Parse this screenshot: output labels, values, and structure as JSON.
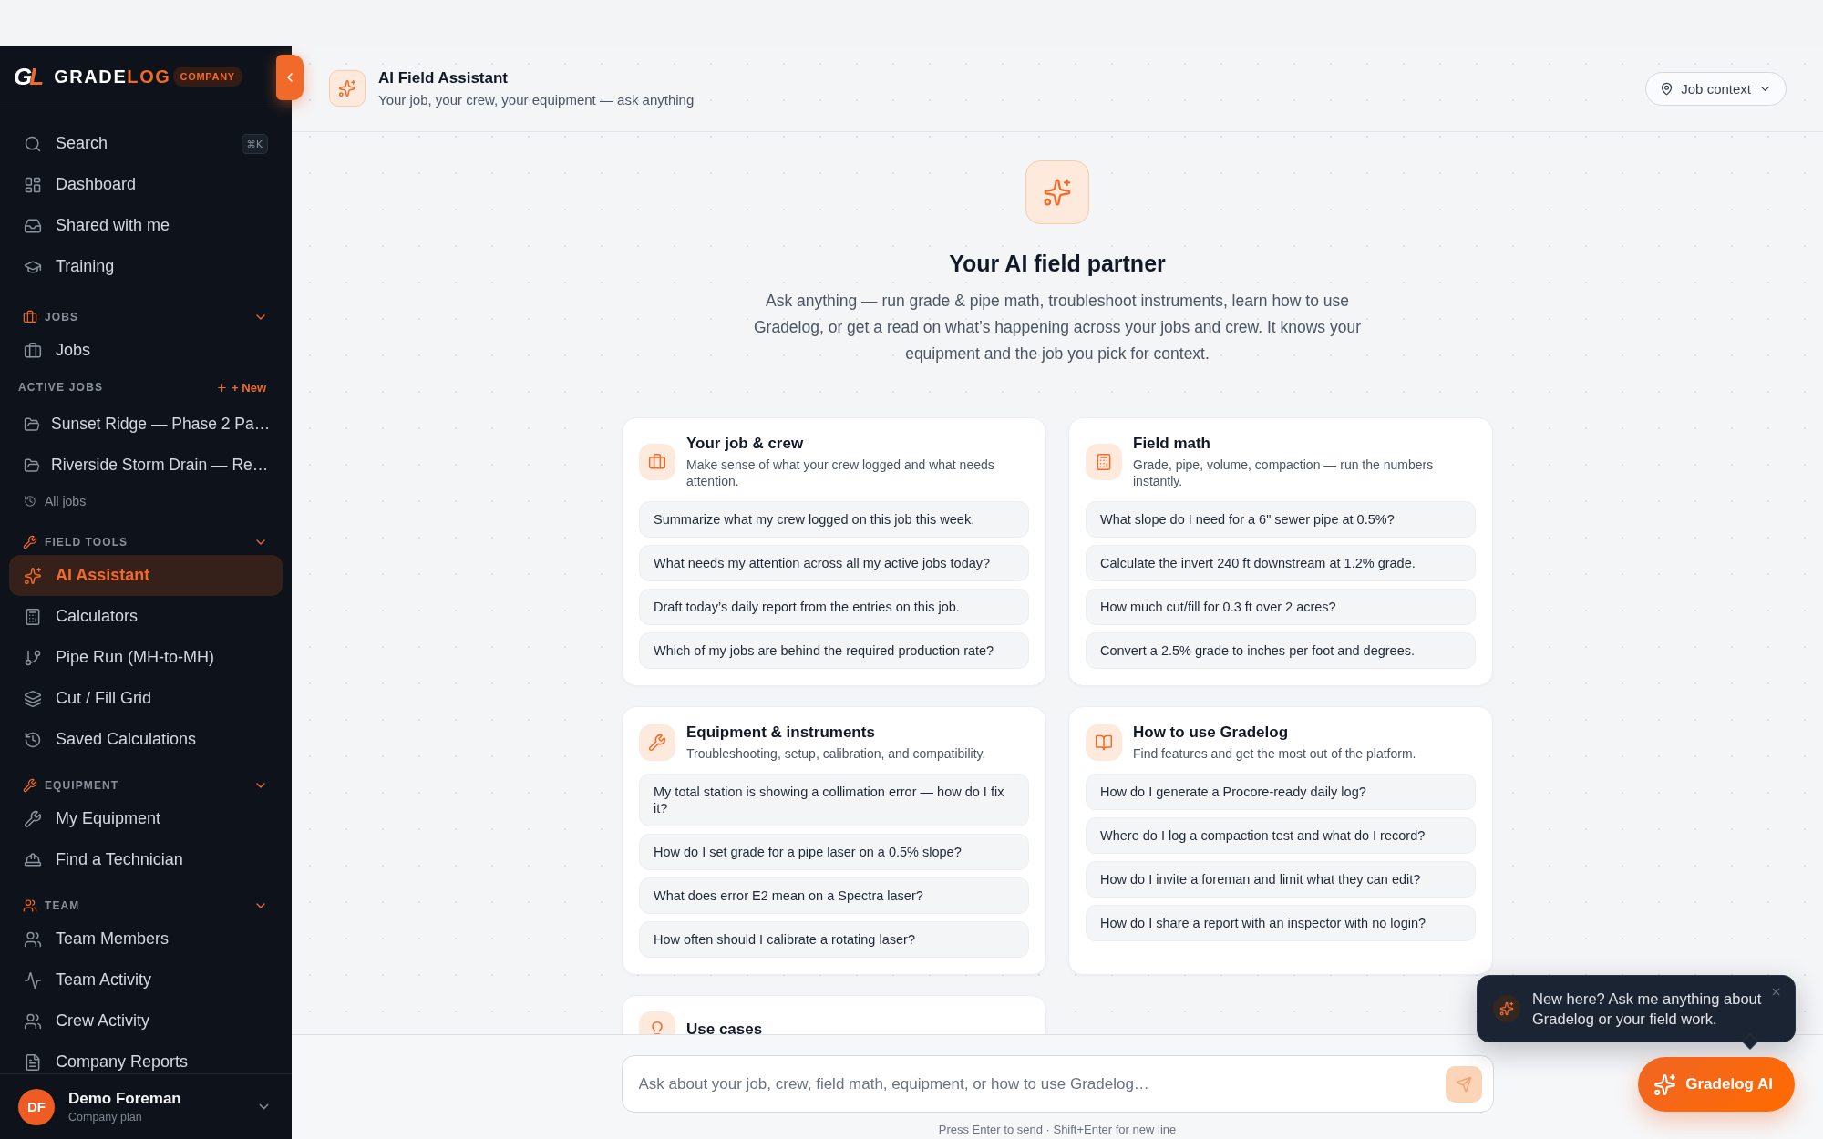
{
  "sidebar": {
    "logo": {
      "mark": "GL",
      "name": "GRADE",
      "name_accent": "LOG",
      "tier": "COMPANY"
    },
    "nav": [
      {
        "label": "Search",
        "shortcut": "⌘K",
        "selected": false
      },
      {
        "label": "Dashboard",
        "selected": false
      },
      {
        "label": "Shared with me",
        "selected": false
      },
      {
        "label": "Training",
        "selected": false
      }
    ],
    "sections": [
      {
        "title": "JOBS",
        "expanded": true,
        "items": [
          {
            "label": "Jobs",
            "selected": false
          }
        ],
        "group": {
          "title": "ACTIVE JOBS",
          "action": "+ New",
          "items": [
            {
              "label": "Sunset Ridge — Phase 2 Pa…",
              "selected": false
            },
            {
              "label": "Riverside Storm Drain — Re…",
              "selected": false
            }
          ],
          "link": "All jobs"
        }
      },
      {
        "title": "FIELD TOOLS",
        "expanded": true,
        "items": [
          {
            "label": "AI Assistant",
            "selected": true
          },
          {
            "label": "Calculators",
            "selected": false
          },
          {
            "label": "Pipe Run (MH-to-MH)",
            "selected": false
          },
          {
            "label": "Cut / Fill Grid",
            "selected": false
          },
          {
            "label": "Saved Calculations",
            "selected": false
          }
        ]
      },
      {
        "title": "EQUIPMENT",
        "expanded": true,
        "items": [
          {
            "label": "My Equipment",
            "selected": false
          },
          {
            "label": "Find a Technician",
            "selected": false
          }
        ]
      },
      {
        "title": "TEAM",
        "expanded": true,
        "items": [
          {
            "label": "Team Members",
            "selected": false
          },
          {
            "label": "Team Activity",
            "selected": false
          },
          {
            "label": "Crew Activity",
            "selected": false
          },
          {
            "label": "Company Reports",
            "selected": false
          }
        ]
      }
    ],
    "user": {
      "initials": "DF",
      "name": "Demo Foreman",
      "plan": "Company plan"
    }
  },
  "header": {
    "title": "AI Field Assistant",
    "subtitle": "Your job, your crew, your equipment — ask anything",
    "context_button": "Job context"
  },
  "hero": {
    "title": "Your AI field partner",
    "description": "Ask anything — run grade & pipe math, troubleshoot instruments, learn how to use Gradelog, or get a read on what’s happening across your jobs and crew. It knows your equipment and the job you pick for context."
  },
  "cards": [
    {
      "title": "Your job & crew",
      "description": "Make sense of what your crew logged and what needs attention.",
      "prompts": [
        "Summarize what my crew logged on this job this week.",
        "What needs my attention across all my active jobs today?",
        "Draft today’s daily report from the entries on this job.",
        "Which of my jobs are behind the required production rate?"
      ]
    },
    {
      "title": "Field math",
      "description": "Grade, pipe, volume, compaction — run the numbers instantly.",
      "prompts": [
        "What slope do I need for a 6\" sewer pipe at 0.5%?",
        "Calculate the invert 240 ft downstream at 1.2% grade.",
        "How much cut/fill for 0.3 ft over 2 acres?",
        "Convert a 2.5% grade to inches per foot and degrees."
      ]
    },
    {
      "title": "Equipment & instruments",
      "description": "Troubleshooting, setup, calibration, and compatibility.",
      "prompts": [
        "My total station is showing a collimation error — how do I fix it?",
        "How do I set grade for a pipe laser on a 0.5% slope?",
        "What does error E2 mean on a Spectra laser?",
        "How often should I calibrate a rotating laser?"
      ]
    },
    {
      "title": "How to use Gradelog",
      "description": "Find features and get the most out of the platform.",
      "prompts": [
        "How do I generate a Procore-ready daily log?",
        "Where do I log a compaction test and what do I record?",
        "How do I invite a foreman and limit what they can edit?",
        "How do I share a report with an inspector with no login?"
      ]
    },
    {
      "title": "Use cases"
    }
  ],
  "composer": {
    "placeholder": "Ask about your job, crew, field math, equipment, or how to use Gradelog…",
    "send_button": {
      "disabled": true
    },
    "hint": "Press Enter to send · Shift+Enter for new line"
  },
  "assistant_popup": {
    "message": "New here? Ask me anything about Gradelog or your field work."
  },
  "launcher": {
    "label": "Gradelog AI"
  }
}
